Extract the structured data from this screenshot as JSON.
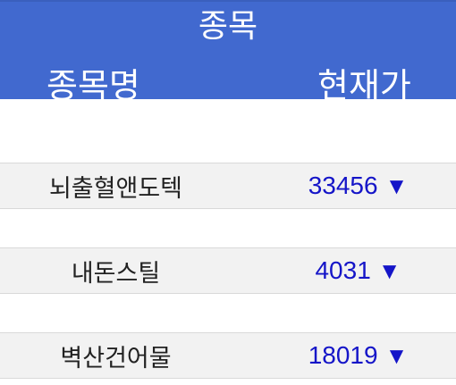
{
  "header": {
    "title": "종목",
    "col_name": "종목명",
    "col_price": "현재가"
  },
  "rows": [
    {
      "name": "뇌출혈앤도텍",
      "price": "33456",
      "direction_icon": "▼"
    },
    {
      "name": "내돈스틸",
      "price": "4031",
      "direction_icon": "▼"
    },
    {
      "name": "벽산건어물",
      "price": "18019",
      "direction_icon": "▼"
    }
  ],
  "colors": {
    "header_bg": "#4169cf",
    "price_down": "#1515c8",
    "row_bg": "#f2f2f2"
  }
}
